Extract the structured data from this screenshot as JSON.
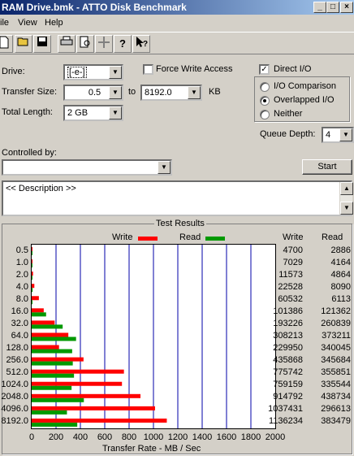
{
  "window": {
    "title": "RAM Drive.bmk - ATTO Disk Benchmark",
    "minimize": "_",
    "maximize": "□",
    "close": "×"
  },
  "menu": [
    "ile",
    "View",
    "Help"
  ],
  "toolbar_icons": [
    "new-icon",
    "open-icon",
    "save-icon",
    "print-icon",
    "print-preview-icon",
    "move-icon",
    "help-icon",
    "context-help-icon"
  ],
  "settings": {
    "drive_label": "Drive:",
    "drive_value": "[-e-]",
    "force_write_label": "Force Write Access",
    "force_write_checked": false,
    "direct_io_label": "Direct I/O",
    "direct_io_checked": true,
    "transfer_size_label": "Transfer Size:",
    "transfer_from": "0.5",
    "to_label": "to",
    "transfer_to": "8192.0",
    "kb_label": "KB",
    "total_length_label": "Total Length:",
    "total_length_value": "2 GB",
    "io_options": [
      {
        "label": "I/O Comparison",
        "selected": false
      },
      {
        "label": "Overlapped I/O",
        "selected": true
      },
      {
        "label": "Neither",
        "selected": false
      }
    ],
    "queue_depth_label": "Queue Depth:",
    "queue_depth_value": "4",
    "controlled_by_label": "Controlled by:",
    "controlled_by_value": "",
    "start_label": "Start",
    "description": "<< Description >>"
  },
  "results": {
    "group_title": "Test Results",
    "write_label": "Write",
    "read_label": "Read",
    "col_write": "Write",
    "col_read": "Read",
    "colors": {
      "write": "#ff0000",
      "read": "#009900",
      "grid": "#0000aa"
    }
  },
  "chart_data": {
    "type": "bar",
    "orientation": "horizontal",
    "xlabel": "Transfer Rate - MB / Sec",
    "xlim": [
      0,
      2000
    ],
    "xticks": [
      0,
      200,
      400,
      600,
      800,
      1000,
      1200,
      1400,
      1600,
      1800,
      2000
    ],
    "categories": [
      "0.5",
      "1.0",
      "2.0",
      "4.0",
      "8.0",
      "16.0",
      "32.0",
      "64.0",
      "128.0",
      "256.0",
      "512.0",
      "1024.0",
      "2048.0",
      "4096.0",
      "8192.0"
    ],
    "series": [
      {
        "name": "Write",
        "values": [
          4.6,
          6.9,
          11.3,
          22.0,
          59.1,
          99.0,
          188.7,
          301.0,
          224.6,
          425.7,
          757.6,
          741.4,
          893.4,
          1013.1,
          1109.6
        ]
      },
      {
        "name": "Read",
        "values": [
          2.8,
          4.1,
          4.8,
          7.9,
          6.0,
          118.5,
          254.5,
          364.5,
          332.5,
          337.6,
          347.5,
          327.7,
          428.5,
          289.7,
          374.5
        ]
      }
    ],
    "write_kbps": [
      "4700",
      "7029",
      "11573",
      "22528",
      "60532",
      "101386",
      "193226",
      "308213",
      "229950",
      "435868",
      "775742",
      "759159",
      "914792",
      "1037431",
      "1136234"
    ],
    "read_kbps": [
      "2886",
      "4164",
      "4864",
      "8090",
      "6113",
      "121362",
      "260839",
      "373211",
      "340045",
      "345684",
      "355851",
      "335544",
      "438734",
      "296613",
      "383479"
    ]
  }
}
